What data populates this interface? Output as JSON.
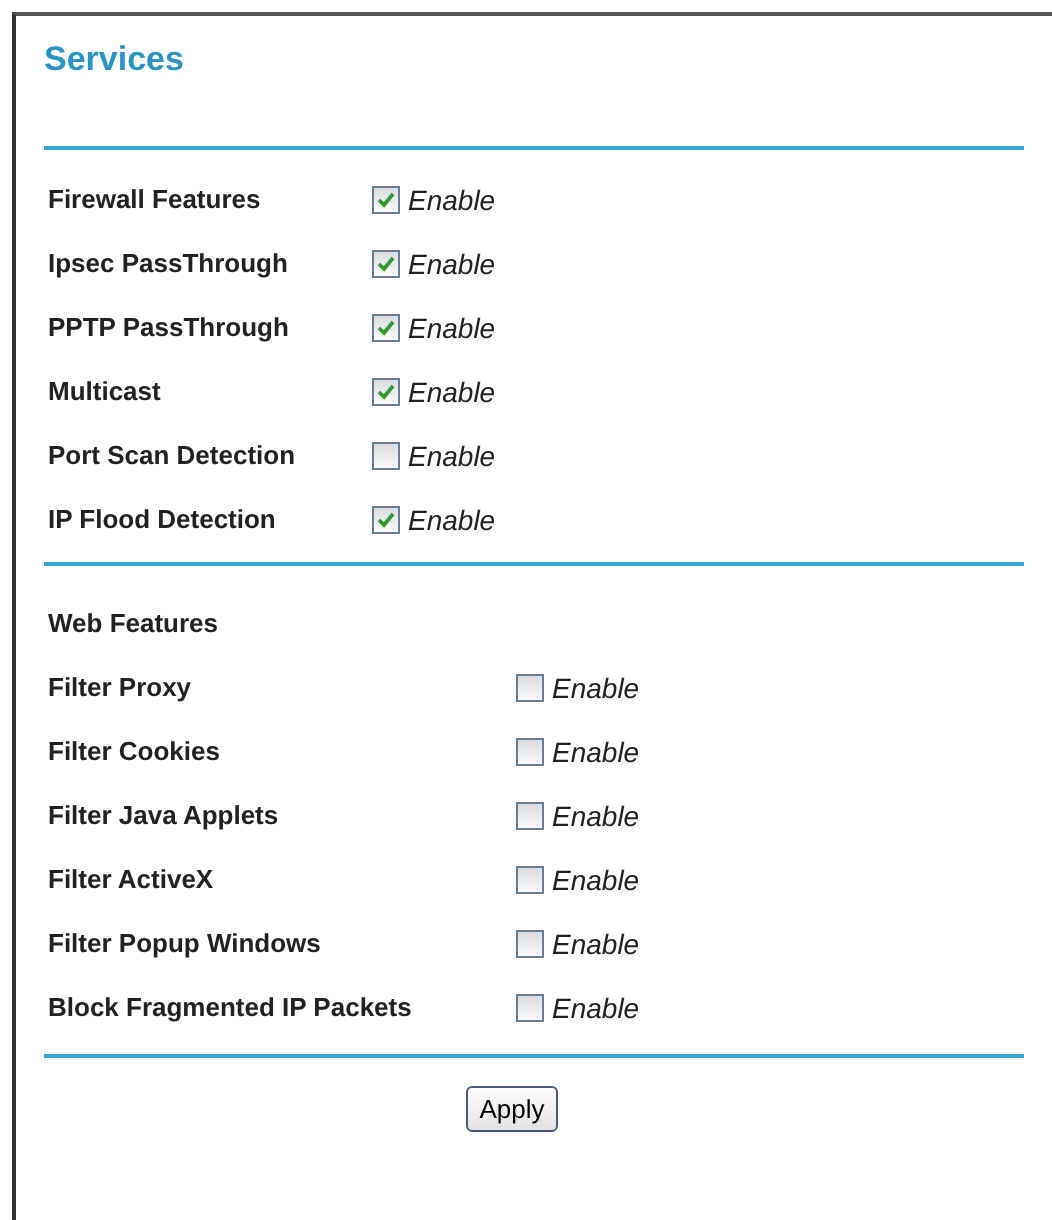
{
  "title": "Services",
  "security_features": [
    {
      "label": "Firewall Features",
      "option": "Enable",
      "checked": true
    },
    {
      "label": "Ipsec PassThrough",
      "option": "Enable",
      "checked": true
    },
    {
      "label": "PPTP PassThrough",
      "option": "Enable",
      "checked": true
    },
    {
      "label": "Multicast",
      "option": "Enable",
      "checked": true
    },
    {
      "label": "Port Scan Detection",
      "option": "Enable",
      "checked": false
    },
    {
      "label": "IP Flood Detection",
      "option": "Enable",
      "checked": true
    }
  ],
  "web_features": {
    "heading": "Web Features",
    "items": [
      {
        "label": "Filter Proxy",
        "option": "Enable",
        "checked": false
      },
      {
        "label": "Filter Cookies",
        "option": "Enable",
        "checked": false
      },
      {
        "label": "Filter Java Applets",
        "option": "Enable",
        "checked": false
      },
      {
        "label": "Filter ActiveX",
        "option": "Enable",
        "checked": false
      },
      {
        "label": "Filter Popup Windows",
        "option": "Enable",
        "checked": false
      },
      {
        "label": "Block Fragmented IP Packets",
        "option": "Enable",
        "checked": false
      }
    ]
  },
  "buttons": [
    "Apply"
  ]
}
